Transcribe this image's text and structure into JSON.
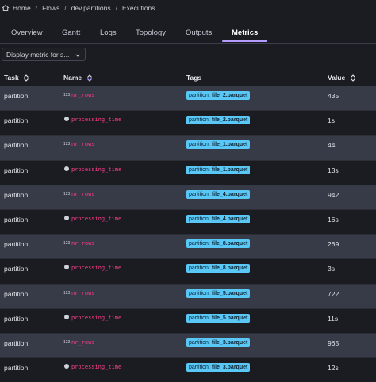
{
  "breadcrumb": {
    "items": [
      "Home",
      "Flows",
      "dev.partitions",
      "Executions"
    ],
    "separator": "/"
  },
  "tabs": [
    {
      "label": "Overview",
      "active": false
    },
    {
      "label": "Gantt",
      "active": false
    },
    {
      "label": "Logs",
      "active": false
    },
    {
      "label": "Topology",
      "active": false
    },
    {
      "label": "Outputs",
      "active": false
    },
    {
      "label": "Metrics",
      "active": true
    }
  ],
  "filter": {
    "label": "Display metric for s..."
  },
  "table": {
    "headers": {
      "task": "Task",
      "name": "Name",
      "tags": "Tags",
      "value": "Value"
    },
    "tag_key": "partition:",
    "rows": [
      {
        "task": "partition",
        "icon": "counter-icon",
        "icon_glyph": "123",
        "name": "nr_rows",
        "tag": "file_2.parquet",
        "value": "435"
      },
      {
        "task": "partition",
        "icon": "timer-icon",
        "icon_glyph": "",
        "name": "processing_time",
        "tag": "file_2.parquet",
        "value": "1s"
      },
      {
        "task": "partition",
        "icon": "counter-icon",
        "icon_glyph": "123",
        "name": "nr_rows",
        "tag": "file_1.parquet",
        "value": "44"
      },
      {
        "task": "partition",
        "icon": "timer-icon",
        "icon_glyph": "",
        "name": "processing_time",
        "tag": "file_1.parquet",
        "value": "13s"
      },
      {
        "task": "partition",
        "icon": "counter-icon",
        "icon_glyph": "123",
        "name": "nr_rows",
        "tag": "file_4.parquet",
        "value": "942"
      },
      {
        "task": "partition",
        "icon": "timer-icon",
        "icon_glyph": "",
        "name": "processing_time",
        "tag": "file_4.parquet",
        "value": "16s"
      },
      {
        "task": "partition",
        "icon": "counter-icon",
        "icon_glyph": "123",
        "name": "nr_rows",
        "tag": "file_8.parquet",
        "value": "269"
      },
      {
        "task": "partition",
        "icon": "timer-icon",
        "icon_glyph": "",
        "name": "processing_time",
        "tag": "file_8.parquet",
        "value": "3s"
      },
      {
        "task": "partition",
        "icon": "counter-icon",
        "icon_glyph": "123",
        "name": "nr_rows",
        "tag": "file_5.parquet",
        "value": "722"
      },
      {
        "task": "partition",
        "icon": "timer-icon",
        "icon_glyph": "",
        "name": "processing_time",
        "tag": "file_5.parquet",
        "value": "11s"
      },
      {
        "task": "partition",
        "icon": "counter-icon",
        "icon_glyph": "123",
        "name": "nr_rows",
        "tag": "file_3.parquet",
        "value": "965"
      },
      {
        "task": "partition",
        "icon": "timer-icon",
        "icon_glyph": "",
        "name": "processing_time",
        "tag": "file_3.parquet",
        "value": "12s"
      }
    ]
  },
  "colors": {
    "accent": "#b49cff",
    "metric_name": "#ff3d8b",
    "tag_bg": "#5ac8f7",
    "row_alt": "#373a47",
    "background": "#1b1c22"
  }
}
